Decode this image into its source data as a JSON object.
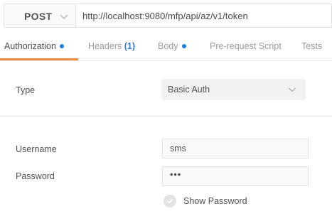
{
  "request": {
    "method": "POST",
    "url": "http://localhost:9080/mfp/api/az/v1/token"
  },
  "tabs": [
    {
      "label": "Authorization",
      "active": true,
      "dot": true
    },
    {
      "label": "Headers",
      "count": "(1)"
    },
    {
      "label": "Body",
      "dot": true
    },
    {
      "label": "Pre-request Script"
    },
    {
      "label": "Tests"
    }
  ],
  "auth": {
    "type_label": "Type",
    "type_value": "Basic Auth",
    "username_label": "Username",
    "username_value": "sms",
    "password_label": "Password",
    "password_value": "•••",
    "show_password_label": "Show Password",
    "show_password_checked": false
  },
  "colors": {
    "active_tab_underline": "#f08b3e",
    "indicator_dot": "#1f7fe0",
    "headers_count": "#3a7bd5"
  }
}
